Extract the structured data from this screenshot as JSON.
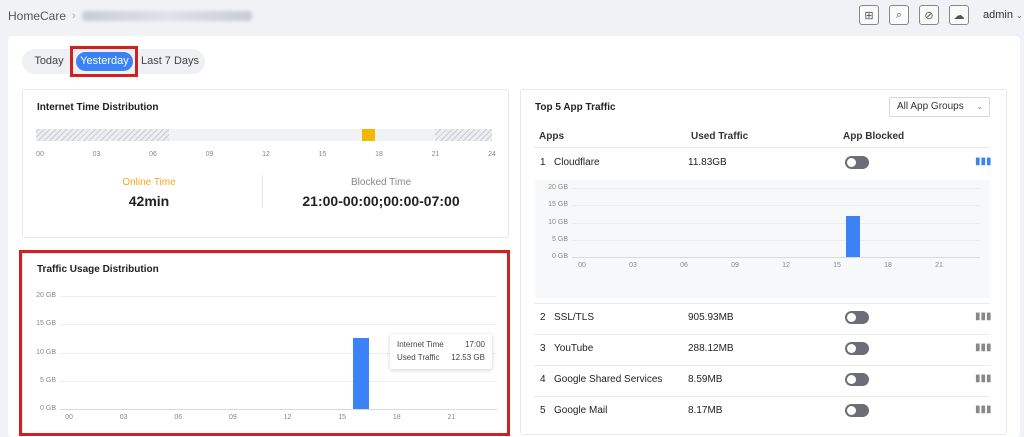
{
  "header": {
    "breadcrumb_root": "HomeCare",
    "breadcrumb_sep": "›",
    "user": "admin",
    "icons": [
      "network-add-icon",
      "search-refresh-icon",
      "compass-icon",
      "cloud-settings-icon"
    ]
  },
  "period_tabs": {
    "today": "Today",
    "yesterday": "Yesterday",
    "last7": "Last 7 Days",
    "selected": "yesterday"
  },
  "internet_time": {
    "title": "Internet Time Distribution",
    "ticks": [
      "00",
      "03",
      "06",
      "09",
      "12",
      "15",
      "18",
      "21",
      "24"
    ],
    "online_label": "Online Time",
    "online_value": "42min",
    "blocked_label": "Blocked Time",
    "blocked_value": "21:00-00:00;00:00-07:00",
    "blocked_hours": [
      [
        0,
        7
      ],
      [
        21,
        24
      ]
    ],
    "online_hours": [
      [
        17,
        18
      ]
    ]
  },
  "traffic": {
    "title": "Traffic Usage Distribution",
    "tooltip": {
      "time_label": "Internet Time",
      "time_value": "17:00",
      "traffic_label": "Used Traffic",
      "traffic_value": "12.53 GB"
    }
  },
  "top5": {
    "title": "Top 5 App Traffic",
    "group_select": "All App Groups",
    "col_apps": "Apps",
    "col_traffic": "Used Traffic",
    "col_blocked": "App Blocked",
    "apps": [
      {
        "rank": "1",
        "name": "Cloudflare",
        "traffic": "11.83GB",
        "blocked": false
      },
      {
        "rank": "2",
        "name": "SSL/TLS",
        "traffic": "905.93MB",
        "blocked": false
      },
      {
        "rank": "3",
        "name": "YouTube",
        "traffic": "288.12MB",
        "blocked": false
      },
      {
        "rank": "4",
        "name": "Google Shared Services",
        "traffic": "8.59MB",
        "blocked": false
      },
      {
        "rank": "5",
        "name": "Google Mail",
        "traffic": "8.17MB",
        "blocked": false
      }
    ]
  },
  "chart_data": [
    {
      "type": "bar",
      "title": "Traffic Usage Distribution",
      "x": [
        17
      ],
      "values": [
        12.53
      ],
      "xticks": [
        "00",
        "03",
        "06",
        "09",
        "12",
        "15",
        "18",
        "21"
      ],
      "yticks": [
        "20 GB",
        "15 GB",
        "10 GB",
        "5 GB",
        "0 GB"
      ],
      "ylim": [
        0,
        20
      ],
      "xlim": [
        0,
        24
      ],
      "unit": "GB"
    },
    {
      "type": "bar",
      "title": "Cloudflare",
      "x": [
        17
      ],
      "values": [
        11.83
      ],
      "xticks": [
        "00",
        "03",
        "06",
        "09",
        "12",
        "15",
        "18",
        "21"
      ],
      "yticks": [
        "20 GB",
        "15 GB",
        "10 GB",
        "5 GB",
        "0 GB"
      ],
      "ylim": [
        0,
        20
      ],
      "xlim": [
        0,
        24
      ],
      "unit": "GB"
    }
  ]
}
